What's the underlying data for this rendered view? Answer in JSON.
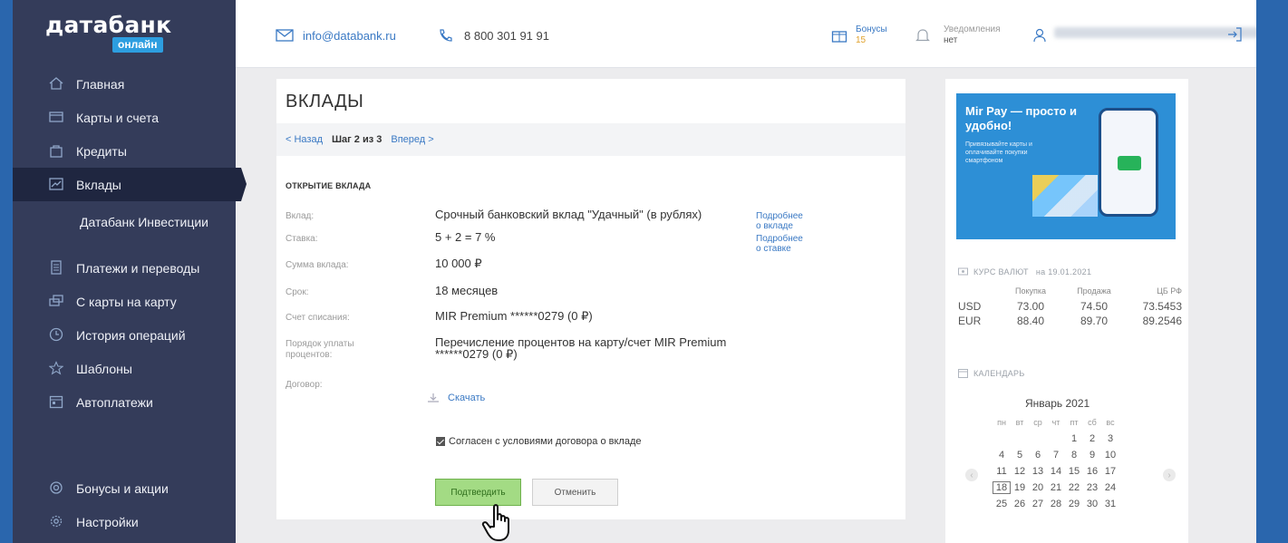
{
  "brand": {
    "name": "датабанк",
    "sub": "онлайн"
  },
  "sidebar": {
    "items": [
      {
        "label": "Главная",
        "icon": "home-icon"
      },
      {
        "label": "Карты и счета",
        "icon": "cards-icon"
      },
      {
        "label": "Кредиты",
        "icon": "bag-icon"
      },
      {
        "label": "Вклады",
        "icon": "chart-icon",
        "active": true
      },
      {
        "label": "Датабанк Инвестиции",
        "icon": ""
      },
      {
        "label": "Платежи и переводы",
        "icon": "document-icon"
      },
      {
        "label": "С карты на карту",
        "icon": "transfer-icon"
      },
      {
        "label": "История операций",
        "icon": "clock-icon"
      },
      {
        "label": "Шаблоны",
        "icon": "star-icon"
      },
      {
        "label": "Автоплатежи",
        "icon": "calendar-icon"
      }
    ],
    "bottom": [
      {
        "label": "Бонусы и акции",
        "icon": "gift-icon"
      },
      {
        "label": "Настройки",
        "icon": "gear-icon"
      }
    ]
  },
  "header": {
    "email": "info@databank.ru",
    "phone": "8 800 301 91 91",
    "bonuses_label": "Бонусы",
    "bonuses_value": "15",
    "notifications_label": "Уведомления",
    "notifications_value": "нет"
  },
  "main": {
    "title": "ВКЛАДЫ",
    "step": {
      "back": "< Назад",
      "current": "Шаг 2 из 3",
      "forward": "Вперед >"
    },
    "section": "ОТКРЫТИЕ ВКЛАДА",
    "fields": [
      {
        "key": "Вклад:",
        "value": "Срочный банковский вклад \"Удачный\" (в рублях)",
        "more": "Подробнее о вкладе"
      },
      {
        "key": "Ставка:",
        "value": "5 + 2 = 7 %",
        "more": "Подробнее о ставке"
      },
      {
        "key": "Сумма вклада:",
        "value": "10 000 ₽"
      },
      {
        "key": "Срок:",
        "value": "18 месяцев"
      },
      {
        "key": "Счет списания:",
        "value": "MIR Premium ******0279 (0 ₽)"
      },
      {
        "key": "Порядок уплаты процентов:",
        "value": "Перечисление процентов на карту/счет MIR Premium ******0279 (0 ₽)"
      },
      {
        "key": "Договор:",
        "value": ""
      }
    ],
    "download": "Скачать",
    "agree": "Согласен с условиями договора о вкладе",
    "confirm": "Подтвердить",
    "cancel": "Отменить"
  },
  "promo": {
    "title": "Mir Pay — просто и удобно!",
    "text": "Привязывайте карты и оплачивайте покупки смартфоном"
  },
  "rates": {
    "title": "КУРС ВАЛЮТ",
    "date": "на 19.01.2021",
    "headers": [
      "Покупка",
      "Продажа",
      "ЦБ РФ"
    ],
    "rows": [
      {
        "cur": "USD",
        "buy": "73.00",
        "sell": "74.50",
        "cb": "73.5453"
      },
      {
        "cur": "EUR",
        "buy": "88.40",
        "sell": "89.70",
        "cb": "89.2546"
      }
    ]
  },
  "calendar": {
    "title": "КАЛЕНДАРЬ",
    "month": "Январь 2021",
    "weekdays": [
      "пн",
      "вт",
      "ср",
      "чт",
      "пт",
      "сб",
      "вс"
    ],
    "weeks": [
      [
        "",
        "",
        "",
        "",
        "1",
        "2",
        "3"
      ],
      [
        "4",
        "5",
        "6",
        "7",
        "8",
        "9",
        "10"
      ],
      [
        "11",
        "12",
        "13",
        "14",
        "15",
        "16",
        "17"
      ],
      [
        "18",
        "19",
        "20",
        "21",
        "22",
        "23",
        "24"
      ],
      [
        "25",
        "26",
        "27",
        "28",
        "29",
        "30",
        "31"
      ]
    ],
    "today": "18"
  }
}
